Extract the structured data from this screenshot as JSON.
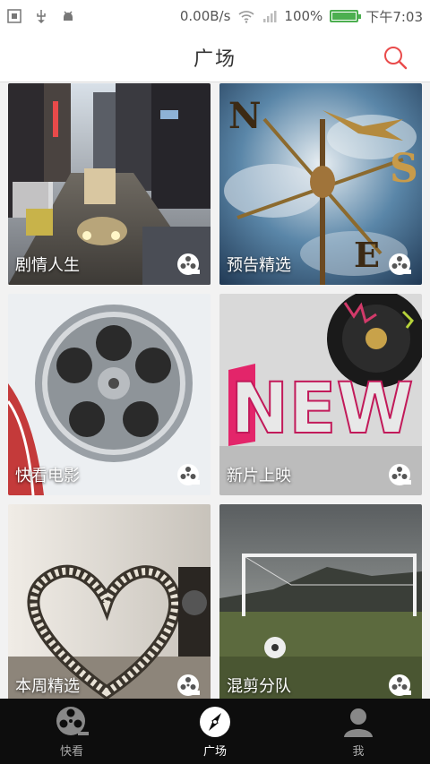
{
  "status": {
    "net_speed": "0.00B/s",
    "battery_pct": "100%",
    "battery_level": 1.0,
    "time": "下午7:03"
  },
  "header": {
    "title": "广场"
  },
  "cards": [
    {
      "label": "剧情人生"
    },
    {
      "label": "预告精选"
    },
    {
      "label": "快看电影"
    },
    {
      "label": "新片上映"
    },
    {
      "label": "本周精选"
    },
    {
      "label": "混剪分队"
    }
  ],
  "tabs": [
    {
      "label": "快看",
      "icon": "film-reel-icon"
    },
    {
      "label": "广场",
      "icon": "compass-icon",
      "active": true
    },
    {
      "label": "我",
      "icon": "user-icon"
    }
  ],
  "colors": {
    "accent": "#e94b4b",
    "tabbar": "#0d0d0d"
  }
}
